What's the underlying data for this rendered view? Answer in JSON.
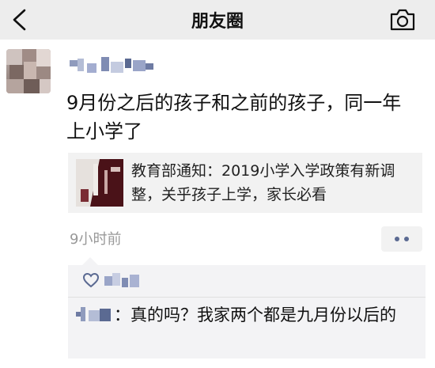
{
  "navbar": {
    "title": "朋友圈",
    "back_icon": "chevron-left-icon",
    "camera_icon": "camera-icon"
  },
  "post": {
    "author_avatar": "avatar (pixelated)",
    "author_name": "",
    "text": "9月份之后的孩子和之前的孩子，同一年上小学了",
    "link_card": {
      "title": "教育部通知：2019小学入学政策有新调整，关乎孩子上学，家长必看"
    },
    "time": "9小时前",
    "more_icon": "more-dots-icon"
  },
  "interactions": {
    "like_icon": "heart-icon",
    "liker_name": "",
    "comments": [
      {
        "author": "",
        "text": "：真的吗？我家两个都是九月份以后的"
      }
    ]
  },
  "colors": {
    "navbar_bg": "#ededed",
    "link_card_bg": "#f2f2f2",
    "interaction_bg": "#f3f3f5",
    "name_blue": "#5b6a92",
    "time_gray": "#999999"
  }
}
